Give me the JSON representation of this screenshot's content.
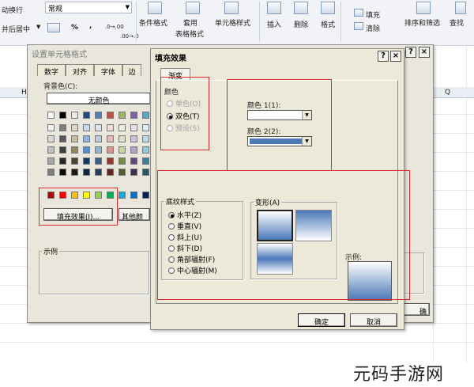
{
  "ribbon": {
    "wrap_text": "动换行",
    "merge_center": "并后居中",
    "number_format": "常规",
    "percent": "%",
    "comma": ",",
    "increase_decimal": ".0→.00",
    "decrease_decimal": ".00→.0",
    "conditional_format": "条件格式",
    "table_format_1": "套用",
    "table_format_2": "表格格式",
    "cell_styles": "单元格样式",
    "insert": "插入",
    "delete": "删除",
    "format": "格式",
    "fill": "填充",
    "clear": "清除",
    "sort_filter": "排序和筛选",
    "find": "查找"
  },
  "sheet": {
    "col_h": "H",
    "col_q": "Q"
  },
  "format_cells_dialog": {
    "title": "设置单元格格式",
    "tabs": [
      "数字",
      "对齐",
      "字体",
      "边"
    ],
    "bg_color_label": "背景色(C):",
    "no_color": "无颜色",
    "fill_effects_button": "填充效果(I)...",
    "more_colors_button": "其他颜色",
    "sample_label": "示例",
    "ok_partial": "确"
  },
  "fill_effects_dialog": {
    "title": "填充效果",
    "help": "?",
    "close": "×",
    "tab_gradient": "渐变",
    "colors_label": "颜色",
    "radio_one_color": "单色(O)",
    "radio_two_colors": "双色(T)",
    "radio_preset": "预设(S)",
    "color1_label": "颜色 1(1):",
    "color2_label": "颜色 2(2):",
    "color1_value": "#ffffff",
    "color2_value": "#4a78b8",
    "shading_styles_label": "底纹样式",
    "shading_horizontal": "水平(Z)",
    "shading_vertical": "垂直(V)",
    "shading_diag_up": "斜上(U)",
    "shading_diag_down": "斜下(D)",
    "shading_from_corner": "角部辐射(F)",
    "shading_from_center": "中心辐射(M)",
    "variants_label": "变形(A)",
    "sample_label": "示例:",
    "ok_button": "确定",
    "cancel_button": "取消"
  },
  "watermark": "元码手游网"
}
